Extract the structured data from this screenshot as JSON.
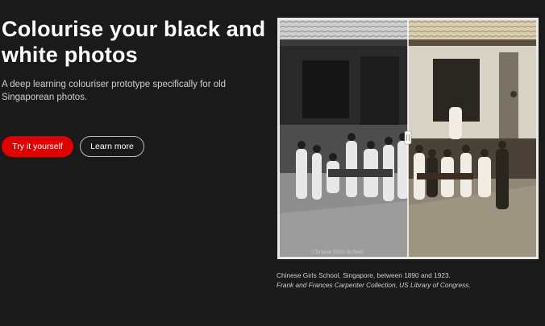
{
  "hero": {
    "title": "Colourise your black and white photos",
    "subtitle": "A deep learning colouriser prototype specifically for old Singaporean photos."
  },
  "buttons": {
    "primary_label": "Try it yourself",
    "secondary_label": "Learn more"
  },
  "photo": {
    "caption": "Chinese Girls School, Singapore, between 1890 and 1923.",
    "credit": "Frank and Frances Carpenter Collection, US Library of Congress.",
    "handle_icon": "drag-handle-icon",
    "split_fraction": 0.5
  },
  "colors": {
    "accent": "#e00000",
    "background": "#1a1a1a"
  }
}
